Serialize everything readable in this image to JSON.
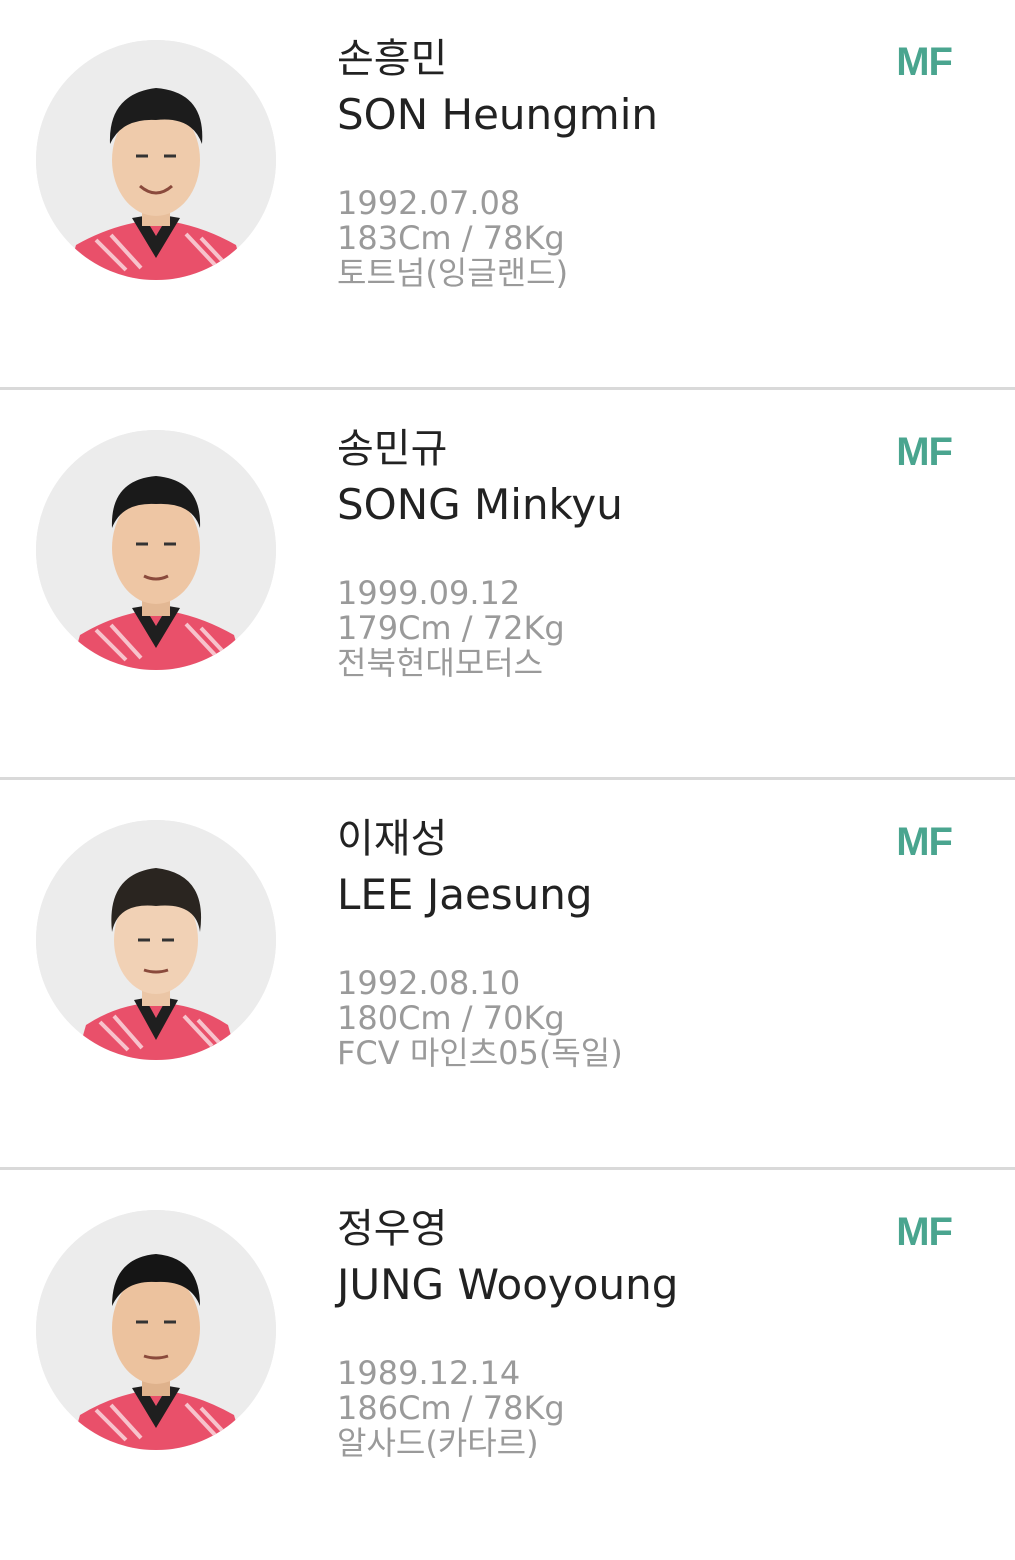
{
  "players": [
    {
      "name_ko": "손흥민",
      "name_en": "SON Heungmin",
      "position": "MF",
      "birth": "1992.07.08",
      "body": "183Cm / 78Kg",
      "club": "토트넘(잉글랜드)",
      "photo_icon": "player-photo"
    },
    {
      "name_ko": "송민규",
      "name_en": "SONG Minkyu",
      "position": "MF",
      "birth": "1999.09.12",
      "body": "179Cm / 72Kg",
      "club": "전북현대모터스",
      "photo_icon": "player-photo"
    },
    {
      "name_ko": "이재성",
      "name_en": "LEE Jaesung",
      "position": "MF",
      "birth": "1992.08.10",
      "body": "180Cm / 70Kg",
      "club": "FCV 마인츠05(독일)",
      "photo_icon": "player-photo"
    },
    {
      "name_ko": "정우영",
      "name_en": "JUNG Wooyoung",
      "position": "MF",
      "birth": "1989.12.14",
      "body": "186Cm / 78Kg",
      "club": "알사드(카타르)",
      "photo_icon": "player-photo"
    }
  ],
  "colors": {
    "position_accent": "#4aa58f",
    "name_text": "#222222",
    "info_text": "#9a9a9a",
    "divider": "#d9d9d9",
    "jersey": "#e9506a",
    "collar": "#1f1f1f"
  }
}
